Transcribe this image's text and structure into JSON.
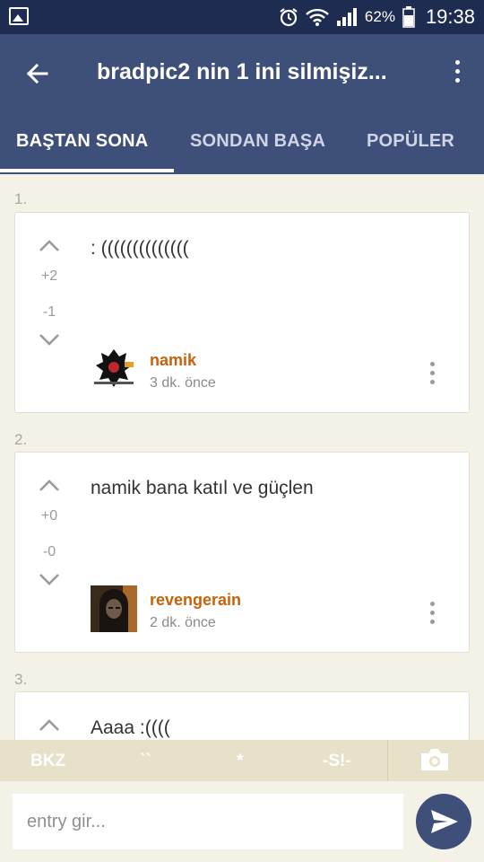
{
  "status_bar": {
    "battery_percent": "62%",
    "time": "19:38"
  },
  "app_bar": {
    "title": "bradpic2 nin 1 ini silmişiz..."
  },
  "tabs": [
    {
      "label": "BAŞTAN SONA",
      "active": true
    },
    {
      "label": "SONDAN BAŞA",
      "active": false
    },
    {
      "label": "POPÜLER",
      "active": false
    }
  ],
  "entries": [
    {
      "number": "1.",
      "text": ": ((((((((((((((",
      "upvotes": "+2",
      "downvotes": "-1",
      "author": "namik",
      "time": "3 dk. önce"
    },
    {
      "number": "2.",
      "text": "namik bana katıl ve güçlen",
      "upvotes": "+0",
      "downvotes": "-0",
      "author": "revengerain",
      "time": "2 dk. önce"
    },
    {
      "number": "3.",
      "text": "Aaaa :((((",
      "upvotes": "",
      "downvotes": "",
      "author": "",
      "time": ""
    }
  ],
  "format_bar": {
    "bkz": "BKZ",
    "backticks": "``",
    "asterisk": "*",
    "spoiler": "-S!-"
  },
  "input": {
    "placeholder": "entry gir..."
  },
  "colors": {
    "status_bar": "#1f2c52",
    "app_bar": "#3e4f7a",
    "author": "#c8620a",
    "background": "#f4f1e6",
    "format_bar": "#e7e1c9"
  }
}
